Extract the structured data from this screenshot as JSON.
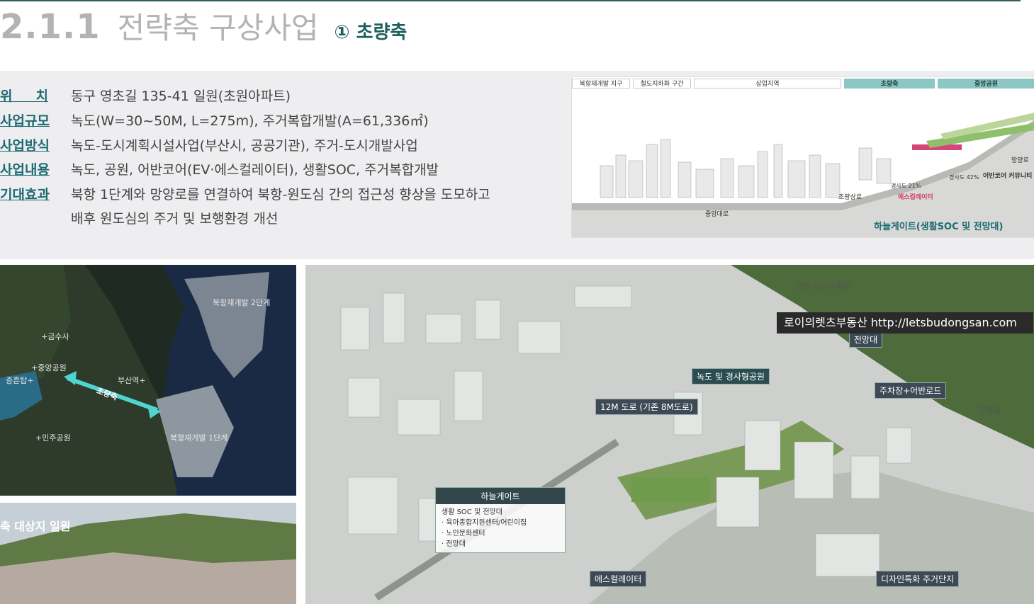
{
  "header": {
    "section_number": "2.1.1",
    "title": "전략축 구상사업",
    "subtitle": "① 초량축"
  },
  "info": {
    "rows": [
      {
        "label": "위     치",
        "value": "동구 영초길 135-41 일원(초원아파트)"
      },
      {
        "label": "사업규모",
        "value": "녹도(W=30~50M, L=275m), 주거복합개발(A=61,336㎡)"
      },
      {
        "label": "사업방식",
        "value": "녹도-도시계획시설사업(부산시, 공공기관), 주거-도시개발사업"
      },
      {
        "label": "사업내용",
        "value": "녹도, 공원, 어반코어(EV·에스컬레이터), 생활SOC, 주거복합개발"
      },
      {
        "label": "기대효과",
        "value": "북항 1단계와 망양로를 연결하여 북항-원도심 간의 접근성 향상을 도모하고"
      },
      {
        "label": "",
        "value": "배후 원도심의 주거 및 보행환경 개선"
      }
    ]
  },
  "section_diagram": {
    "headers": [
      "북항재개발 지구",
      "철도지하화 구간",
      "상업지역",
      "초량축",
      "중앙공원"
    ],
    "labels": {
      "road_center": "중앙대로",
      "road_choryang": "초량상로",
      "slope1": "경사도 21%",
      "slope2": "경사도 42%",
      "escalator": "에스컬레이터",
      "urban_core": "어반코어 커뮤니티",
      "mangyang": "망양로"
    },
    "caption": "하늘게이트(생활SOC 및 전망대)"
  },
  "map": {
    "labels": [
      "북항재개발 2단계",
      "+금수사",
      "+중앙공원",
      "부산역+",
      "증흔탑+",
      "+민주공원",
      "북항재개발 1단계"
    ],
    "axis_label": "초량축"
  },
  "photo": {
    "label": "축 대상지 일원"
  },
  "render": {
    "watermark": "로이의렛츠부동산 http://letsbudongsan.com",
    "labels": {
      "yeongju": "영주시민아파트",
      "observatory": "전망대",
      "greenway": "녹도 및 경사형공원",
      "parking": "주차장+어반로드",
      "road12": "12M 도로 (기존 8M도로)",
      "mangyang": "망양로",
      "escalator": "에스컬레이터",
      "design_housing": "디자인특화 주거단지"
    },
    "callout": {
      "title": "하늘게이트",
      "lines": [
        "생활 SOC 및 전망대",
        "· 육아종합지원센터/어린이집",
        "· 노인문화센터",
        "· 전망대"
      ]
    }
  }
}
